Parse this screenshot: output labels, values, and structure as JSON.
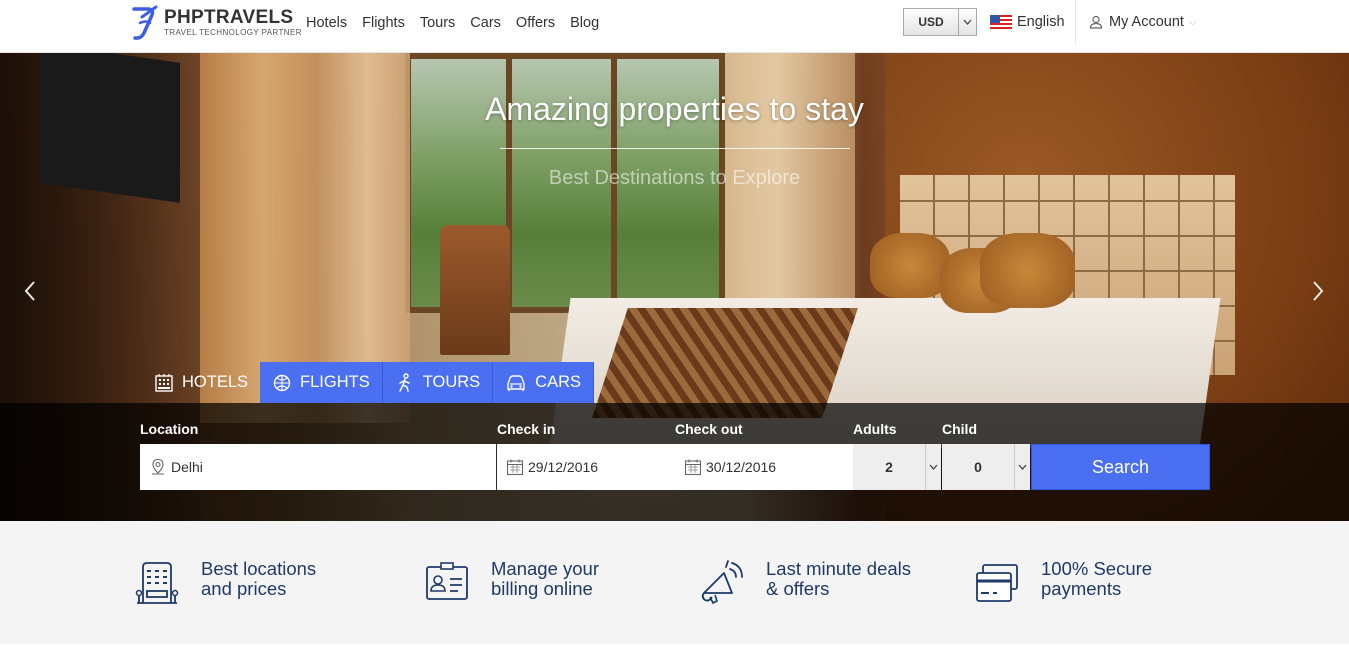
{
  "brand": {
    "name": "PHPTRAVELS",
    "tagline": "TRAVEL TECHNOLOGY PARTNER"
  },
  "nav": {
    "items": [
      "Hotels",
      "Flights",
      "Tours",
      "Cars",
      "Offers",
      "Blog"
    ]
  },
  "header": {
    "currency": "USD",
    "language": "English",
    "account": "My Account"
  },
  "hero": {
    "title": "Amazing properties to stay",
    "subtitle": "Best Destinations to Explore"
  },
  "tabs": [
    {
      "label": "HOTELS",
      "icon": "hotel-icon"
    },
    {
      "label": "FLIGHTS",
      "icon": "flights-icon"
    },
    {
      "label": "TOURS",
      "icon": "tours-icon"
    },
    {
      "label": "CARS",
      "icon": "cars-icon"
    }
  ],
  "search": {
    "location_label": "Location",
    "location_value": "Delhi",
    "checkin_label": "Check in",
    "checkin_value": "29/12/2016",
    "checkout_label": "Check out",
    "checkout_value": "30/12/2016",
    "adults_label": "Adults",
    "adults_value": "2",
    "child_label": "Child",
    "child_value": "0",
    "button": "Search"
  },
  "features": [
    {
      "line1": "Best locations",
      "line2": "and prices",
      "icon": "building-icon"
    },
    {
      "line1": "Manage your",
      "line2": "billing online",
      "icon": "billing-icon"
    },
    {
      "line1": "Last minute deals",
      "line2": "& offers",
      "icon": "megaphone-icon"
    },
    {
      "line1": "100% Secure",
      "line2": "payments",
      "icon": "credit-card-icon"
    }
  ],
  "colors": {
    "accent": "#4a6ff1",
    "feature_text": "#1d3a69"
  }
}
